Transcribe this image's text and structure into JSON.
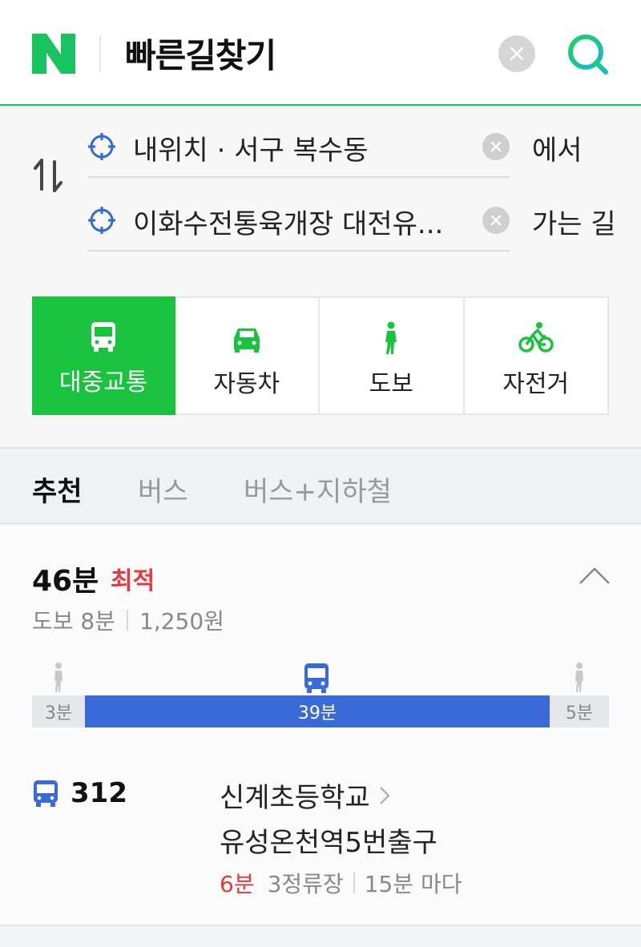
{
  "header": {
    "logo_letter": "N",
    "title": "빠른길찾기",
    "brand_color": "#19c35f"
  },
  "route": {
    "from_text": "내위치 · 서구 복수동",
    "from_suffix": "에서",
    "to_text": "이화수전통육개장 대전유...",
    "to_suffix": "가는 길"
  },
  "modes": [
    {
      "label": "대중교통",
      "icon": "bus-icon",
      "active": true
    },
    {
      "label": "자동차",
      "icon": "car-icon",
      "active": false
    },
    {
      "label": "도보",
      "icon": "walk-icon",
      "active": false
    },
    {
      "label": "자전거",
      "icon": "bicycle-icon",
      "active": false
    }
  ],
  "subtabs": [
    "추천",
    "버스",
    "버스+지하철"
  ],
  "result": {
    "duration": "46분",
    "badge": "최적",
    "walk_time": "도보 8분",
    "fare": "1,250원",
    "timeline": {
      "walk_start": "3분",
      "bus": "39분",
      "walk_end": "5분"
    },
    "bus": {
      "number": "312",
      "from_stop": "신계초등학교",
      "to_stop": "유성온천역5번출구",
      "arrival": "6분",
      "stops": "3정류장",
      "interval": "15분 마다"
    }
  },
  "colors": {
    "accent_green": "#19c33e",
    "bus_blue": "#3a6ad8",
    "badge_red": "#e8383d"
  }
}
